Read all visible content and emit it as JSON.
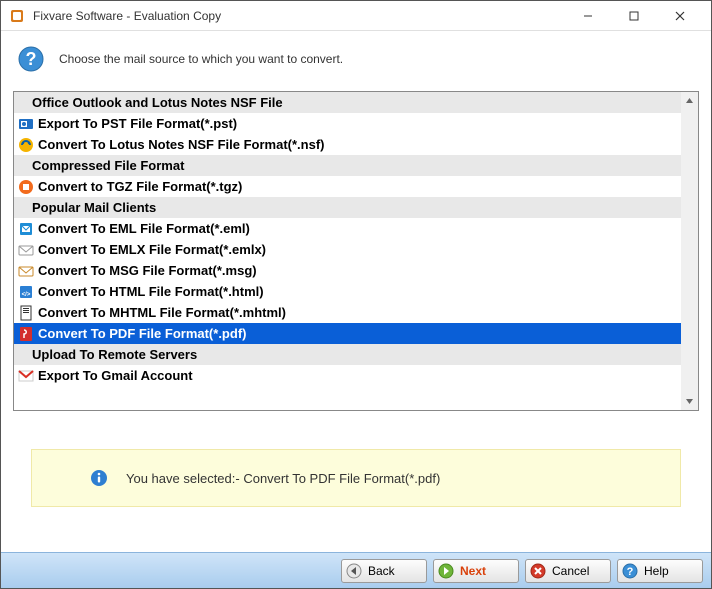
{
  "window": {
    "title": "Fixvare Software - Evaluation Copy"
  },
  "header": {
    "text": "Choose the mail source to which you want to convert."
  },
  "list": {
    "groups": [
      {
        "type": "header",
        "label": "Office Outlook and Lotus Notes NSF File"
      },
      {
        "type": "item",
        "icon": "outlook",
        "label": "Export To PST File Format(*.pst)",
        "selected": false
      },
      {
        "type": "item",
        "icon": "nsf",
        "label": "Convert To Lotus Notes NSF File Format(*.nsf)",
        "selected": false
      },
      {
        "type": "header",
        "label": "Compressed File Format"
      },
      {
        "type": "item",
        "icon": "tgz",
        "label": "Convert to TGZ File Format(*.tgz)",
        "selected": false
      },
      {
        "type": "header",
        "label": "Popular Mail Clients"
      },
      {
        "type": "item",
        "icon": "eml",
        "label": "Convert To EML File Format(*.eml)",
        "selected": false
      },
      {
        "type": "item",
        "icon": "emlx",
        "label": "Convert To EMLX File Format(*.emlx)",
        "selected": false
      },
      {
        "type": "item",
        "icon": "msg",
        "label": "Convert To MSG File Format(*.msg)",
        "selected": false
      },
      {
        "type": "item",
        "icon": "html",
        "label": "Convert To HTML File Format(*.html)",
        "selected": false
      },
      {
        "type": "item",
        "icon": "mhtml",
        "label": "Convert To MHTML File Format(*.mhtml)",
        "selected": false
      },
      {
        "type": "item",
        "icon": "pdf",
        "label": "Convert To PDF File Format(*.pdf)",
        "selected": true
      },
      {
        "type": "header",
        "label": "Upload To Remote Servers"
      },
      {
        "type": "item",
        "icon": "gmail",
        "label": "Export To Gmail Account",
        "selected": false
      }
    ]
  },
  "status": {
    "text": "You have selected:- Convert To PDF File Format(*.pdf)"
  },
  "buttons": {
    "back": "Back",
    "next": "Next",
    "cancel": "Cancel",
    "help": "Help"
  }
}
